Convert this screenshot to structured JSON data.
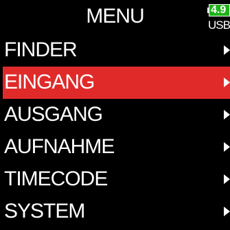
{
  "header": {
    "title": "MENU",
    "battery_text": "4.9",
    "power_source": "USB"
  },
  "menu": {
    "selected_index": 1,
    "items": [
      {
        "label": "FINDER"
      },
      {
        "label": "EINGANG"
      },
      {
        "label": "AUSGANG"
      },
      {
        "label": "AUFNAHME"
      },
      {
        "label": "TIMECODE"
      },
      {
        "label": "SYSTEM"
      }
    ]
  },
  "colors": {
    "background": "#000000",
    "selection": "#e02a2a",
    "battery": "#1fb318",
    "text": "#ffffff"
  }
}
